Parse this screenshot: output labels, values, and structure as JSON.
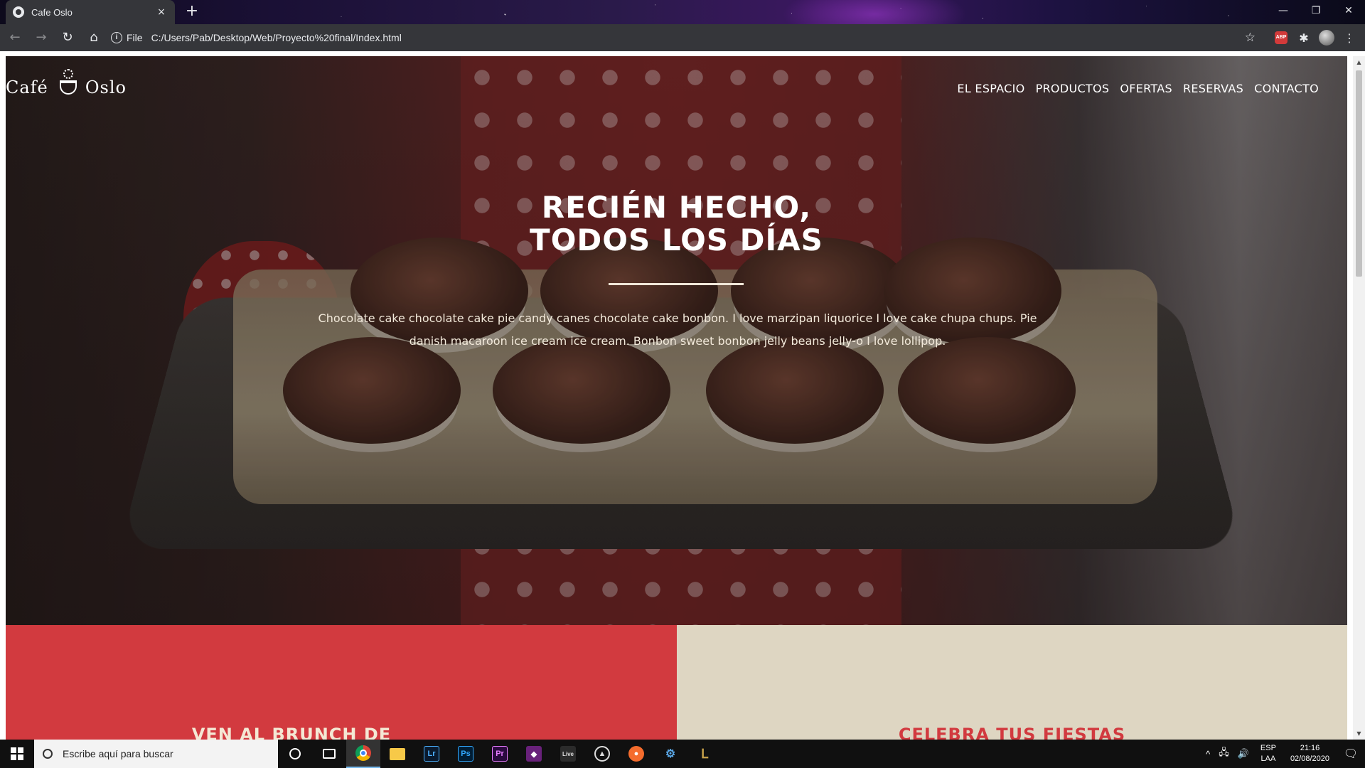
{
  "browser": {
    "tab_title": "Cafe Oslo",
    "tab_close": "×",
    "new_tab": "+",
    "window_controls": [
      "—",
      "❐",
      "✕"
    ],
    "back": "←",
    "forward": "→",
    "reload": "↻",
    "home": "⌂",
    "scheme_label": "File",
    "url": "C:/Users/Pab/Desktop/Web/Proyecto%20final/Index.html",
    "bookmark_star": "☆",
    "abp_label": "ABP",
    "extensions_glyph": "✱",
    "menu_glyph": "⋮"
  },
  "site": {
    "logo": {
      "left": "Café",
      "right": "Oslo"
    },
    "nav": [
      "EL ESPACIO",
      "PRODUCTOS",
      "OFERTAS",
      "RESERVAS",
      "CONTACTO"
    ],
    "hero": {
      "title_line1": "RECIÉN HECHO,",
      "title_line2": "TODOS LOS DÍAS",
      "text": "Chocolate cake chocolate cake pie candy canes chocolate cake bonbon. I love marzipan liquorice I love cake chupa chups. Pie danish macaroon ice cream ice cream. Bonbon sweet bonbon jelly beans jelly-o I love lollipop."
    },
    "panels": {
      "left_title": "VEN AL BRUNCH DE",
      "right_title": "CELEBRA TUS FIESTAS"
    },
    "colors": {
      "accent_red": "#d23a3f",
      "beige": "#ded6c2"
    }
  },
  "taskbar": {
    "search_placeholder": "Escribe aquí para buscar",
    "apps": [
      "Lr",
      "Ps",
      "Pr",
      "Live"
    ],
    "language_line1": "ESP",
    "language_line2": "LAA",
    "time": "21:16",
    "date": "02/08/2020",
    "tray_symbols": [
      "^",
      "🖧",
      "🔊"
    ],
    "notification_glyph": "🗨"
  }
}
